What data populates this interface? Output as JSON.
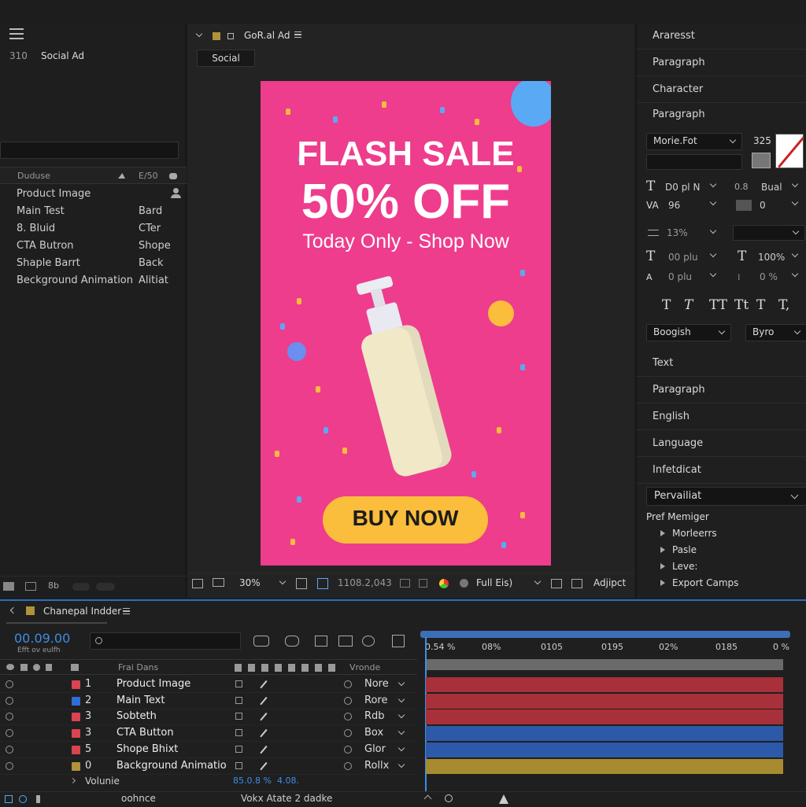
{
  "project": {
    "menu_icon": "hamburger-icon",
    "count": "310",
    "name": "Social Ad",
    "search_placeholder": "",
    "col_name": "Duduse",
    "col_type": "E/50",
    "items": [
      {
        "name": "Product Image",
        "type": ""
      },
      {
        "name": "Main Test",
        "type": "Bard"
      },
      {
        "name": "8. Bluid",
        "type": "CTer"
      },
      {
        "name": "CTA Butron",
        "type": "Shope"
      },
      {
        "name": "Shaple Barrt",
        "type": "Back"
      },
      {
        "name": "Beckground Animation",
        "type": "Alitiat"
      }
    ]
  },
  "viewer": {
    "comp_title": "GoR.al Ad",
    "tab": "Social",
    "zoom": "30%",
    "coords": "1108.2,043",
    "resolution": "Full Eis)",
    "adjust": "Adjipct"
  },
  "ad": {
    "headline": "FLASH SALE",
    "discount": "50% OFF",
    "subline": "Today Only - Shop Now",
    "cta": "BUY NOW",
    "bg_color": "#ee3d8c",
    "cta_color": "#fbbd3c"
  },
  "properties": {
    "sections": [
      "Araresst",
      "Paragraph",
      "Character",
      "Paragraph"
    ],
    "font_family": "Morie.Fot",
    "font_size_label": "325",
    "size_val": "D0 pl N",
    "kerning_label": "Bual",
    "tracking_val": "96",
    "tracking2": "0",
    "leading_val": "13%",
    "vscale_val": "00 plu",
    "hscale_val": "100%",
    "baseline_val": "0 plu",
    "tsume_val": "0 %",
    "style_a": "Boogish",
    "style_b": "Byro",
    "lower_sections": [
      "Text",
      "Paragraph",
      "English",
      "Language",
      "Infetdicat"
    ],
    "preset": "Pervailiat",
    "tree_title": "Pref Memiger",
    "tree_items": [
      "Morleerrs",
      "Pasle",
      "Leve:",
      "Export Camps"
    ]
  },
  "timeline": {
    "comp_name": "Chanepal Indder",
    "timecode": "00.09.00",
    "timecode_sub": "Efft ov eulfh",
    "col_source": "Frai Dans",
    "col_mode": "Vronde",
    "ruler": [
      "0.54 %",
      "08%",
      "0105",
      "0195",
      "02%",
      "0185",
      "0 %"
    ],
    "layers": [
      {
        "num": "1",
        "name": "Product Image",
        "mode": "Nore",
        "label": "#d94450",
        "bar": "#a8303a"
      },
      {
        "num": "2",
        "name": "Main Text",
        "mode": "Rore",
        "label": "#2f6fd6",
        "bar": "#a8303a"
      },
      {
        "num": "3",
        "name": "Sobteth",
        "mode": "Rdb",
        "label": "#d94450",
        "bar": "#a8303a"
      },
      {
        "num": "3",
        "name": "CTA Button",
        "mode": "Box",
        "label": "#d94450",
        "bar": "#2d5aa8"
      },
      {
        "num": "5",
        "name": "Shope Bhixt",
        "mode": "Glor",
        "label": "#d94450",
        "bar": "#2d5aa8"
      },
      {
        "num": "0",
        "name": "Background Animatio",
        "mode": "Rollx",
        "label": "#b0923a",
        "bar": "#a88a30"
      }
    ],
    "volume_label": "Volunie",
    "volume_val": "85.0.8 %",
    "volume_val2": "4.08.",
    "footer_left": "oohnce",
    "footer_mid": "Vokx Atate 2 dadke"
  }
}
